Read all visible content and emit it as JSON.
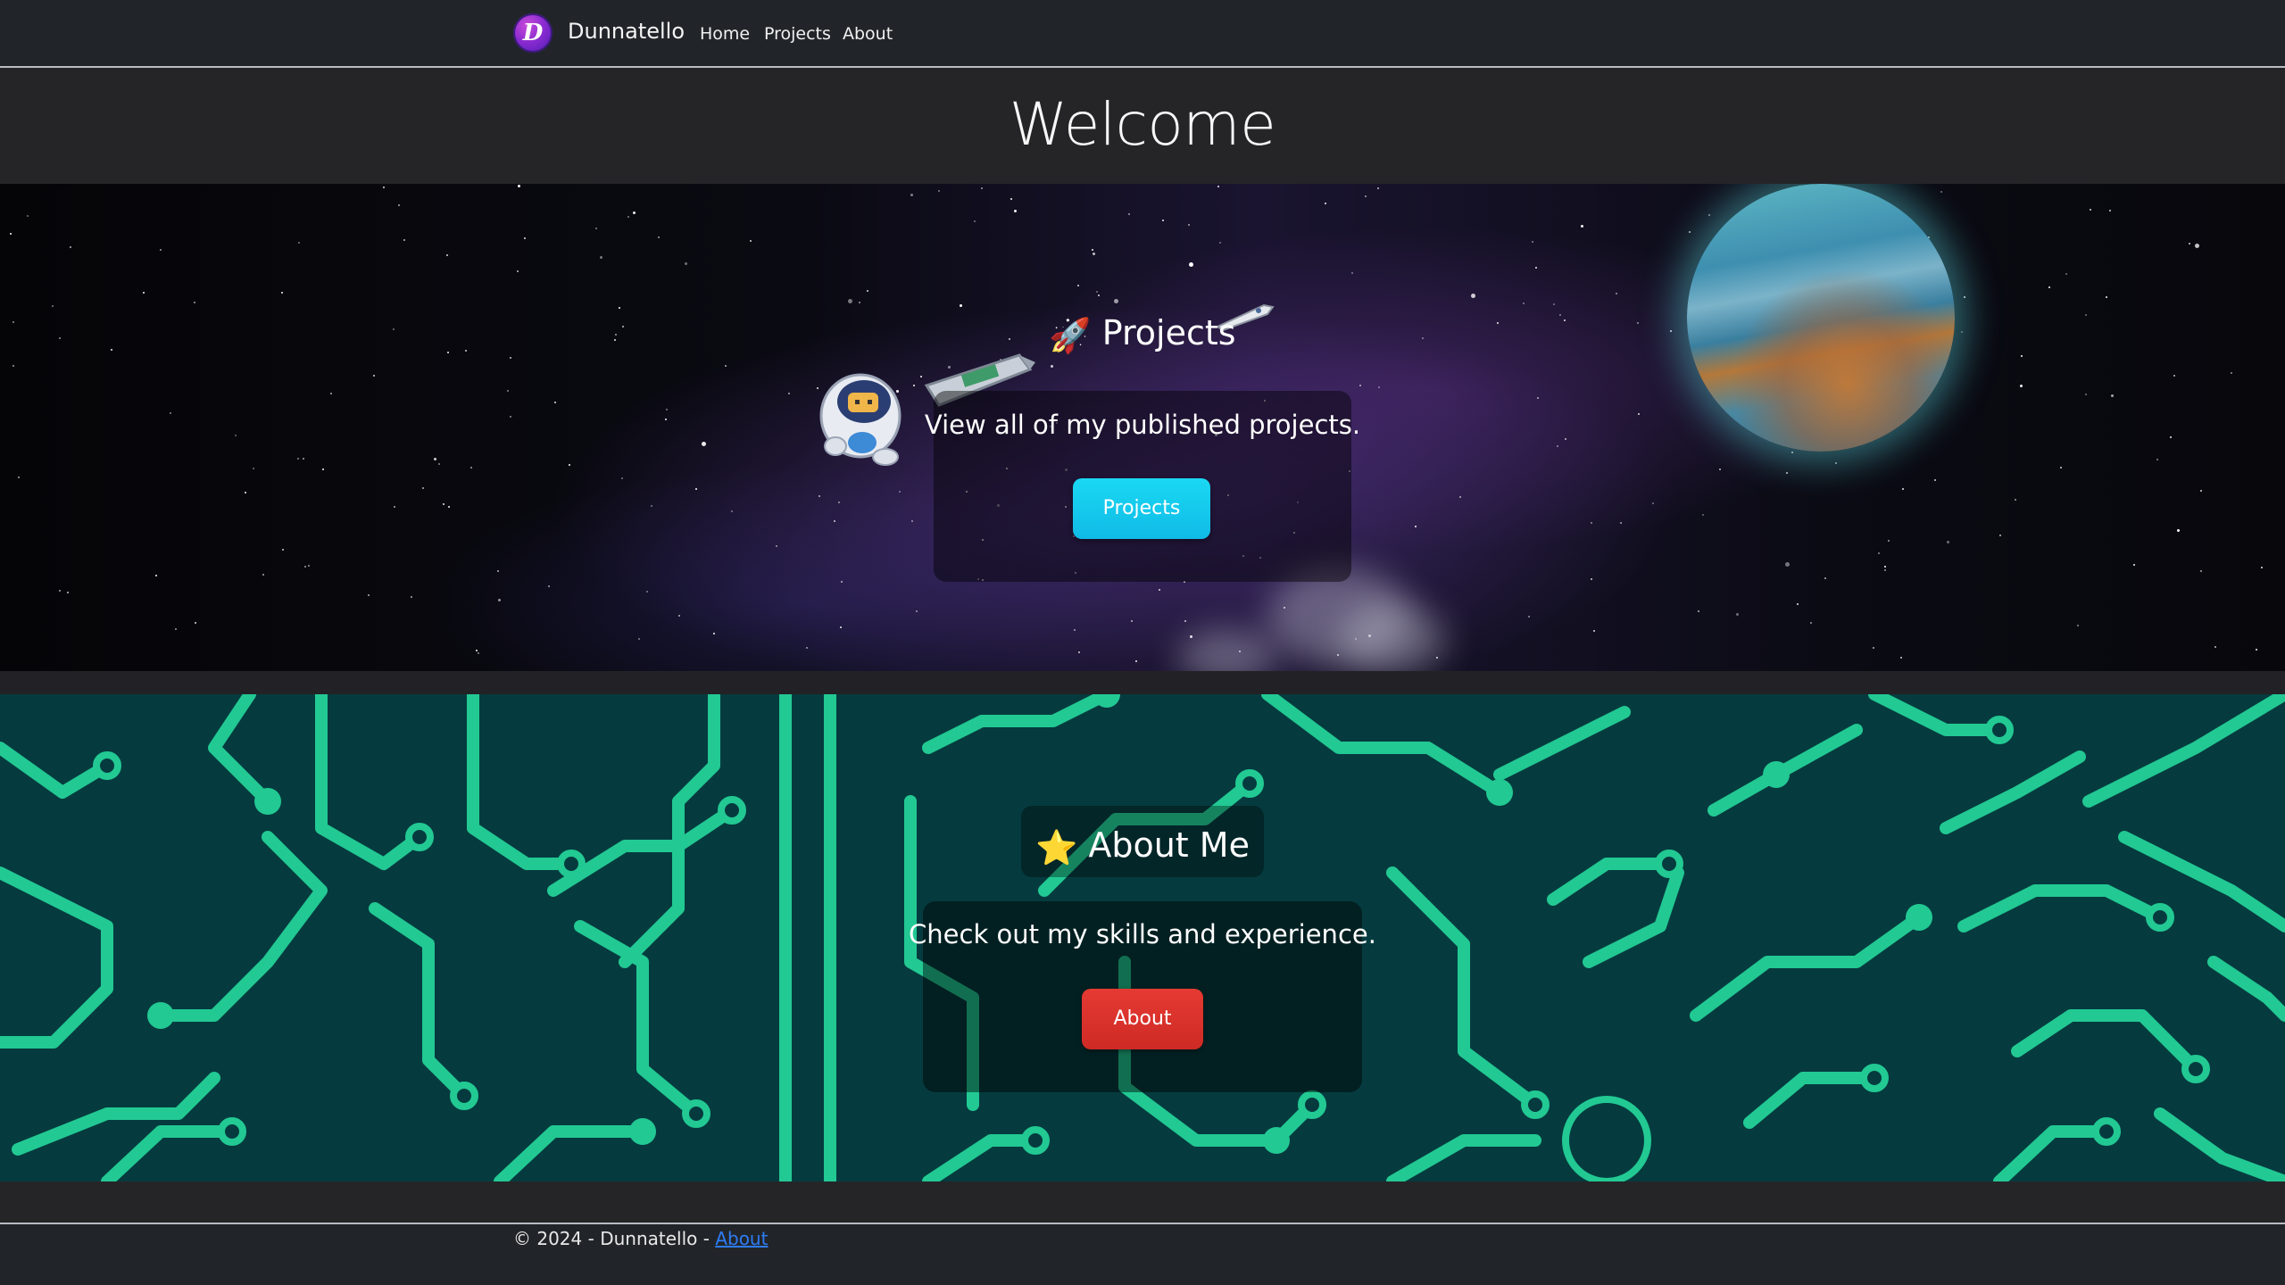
{
  "navbar": {
    "brand_initial": "D",
    "brand_name": "Dunnatello",
    "links": [
      "Home",
      "Projects",
      "About"
    ]
  },
  "welcome": {
    "title": "Welcome"
  },
  "projects_section": {
    "emoji": "🚀",
    "heading": "Projects",
    "description": "View all of my published projects.",
    "button_label": "Projects",
    "button_color": "#13c9ec"
  },
  "about_section": {
    "emoji": "⭐",
    "heading": "About Me",
    "description": "Check out my skills and experience.",
    "button_label": "About",
    "button_color": "#dc3330"
  },
  "footer": {
    "copyright": "© 2024 - Dunnatello - ",
    "link_label": "About"
  },
  "colors": {
    "navbar_bg": "#212529",
    "page_bg": "#252528",
    "circuit_bg": "#053b3f",
    "circuit_trace": "#22c993",
    "link": "#2f7cf6"
  }
}
